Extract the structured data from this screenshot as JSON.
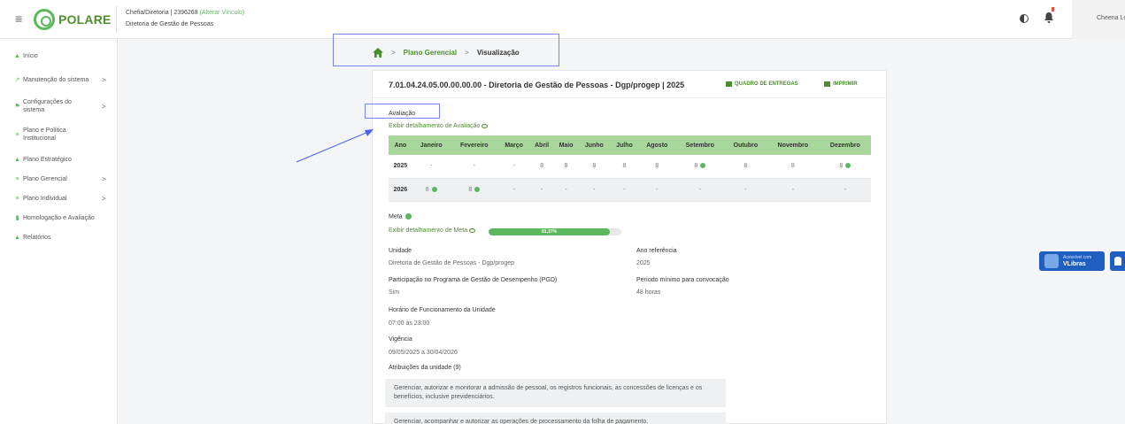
{
  "header": {
    "logo_text": "POLARE",
    "role_prefix": "Chefia/Diretoria | 2396268",
    "role_link": "(Alterar Vínculo)",
    "department": "Diretoria de Gestão de Pessoas",
    "user_name": "Cheena Lope"
  },
  "sidebar": {
    "items": [
      {
        "label": "Início",
        "icon": "home-icon",
        "has_children": false
      },
      {
        "label": "Manutenção do sistema",
        "icon": "wrench-icon",
        "has_children": true
      },
      {
        "label": "Configurações do sistema",
        "icon": "settings-icon",
        "has_children": true
      },
      {
        "label": "Plano e Política Institucional",
        "icon": "list-icon",
        "has_children": false
      },
      {
        "label": "Plano Estratégico",
        "icon": "people-icon",
        "has_children": false
      },
      {
        "label": "Plano Gerencial",
        "icon": "list-icon",
        "has_children": true
      },
      {
        "label": "Plano Individual",
        "icon": "list-icon",
        "has_children": true
      },
      {
        "label": "Homologação e Avaliação",
        "icon": "check-icon",
        "has_children": false
      },
      {
        "label": "Relatórios",
        "icon": "chart-icon",
        "has_children": false
      }
    ],
    "chevron": ">"
  },
  "breadcrumb": {
    "separator": ">",
    "items": [
      "Plano Gerencial",
      "Visualização"
    ]
  },
  "card": {
    "title": "7.01.04.24.05.00.00.00.00 - Diretoria de Gestão de Pessoas - Dgp/progep | 2025",
    "actions": {
      "deliveries": "QUADRO DE ENTREGAS",
      "print": "IMPRIMIR"
    },
    "evaluation": {
      "title": "Avaliação",
      "detail_link": "Exibir detalhamento de Avaliação",
      "columns": [
        "Ano",
        "Janeiro",
        "Fevereiro",
        "Março",
        "Abril",
        "Maio",
        "Junho",
        "Julho",
        "Agosto",
        "Setembro",
        "Outubro",
        "Novembro",
        "Dezembro"
      ],
      "rows": [
        {
          "year": "2025",
          "cells": [
            {
              "v": "-"
            },
            {
              "v": "-"
            },
            {
              "v": "-"
            },
            {
              "v": "8"
            },
            {
              "v": "8"
            },
            {
              "v": "8"
            },
            {
              "v": "8"
            },
            {
              "v": "8"
            },
            {
              "v": "8",
              "dot": true
            },
            {
              "v": "8"
            },
            {
              "v": "8"
            },
            {
              "v": "8",
              "dot": true
            }
          ]
        },
        {
          "year": "2026",
          "cells": [
            {
              "v": "8",
              "dot": true
            },
            {
              "v": "8",
              "dot": true
            },
            {
              "v": "-"
            },
            {
              "v": "-"
            },
            {
              "v": "-"
            },
            {
              "v": "-"
            },
            {
              "v": "-"
            },
            {
              "v": "-"
            },
            {
              "v": "-"
            },
            {
              "v": "-"
            },
            {
              "v": "-"
            },
            {
              "v": "-"
            }
          ]
        }
      ]
    },
    "meta": {
      "title": "Meta",
      "detail_link": "Exibir detalhamento de Meta",
      "progress_percent": 91.37,
      "progress_label": "91,37%"
    },
    "fields": {
      "unidade_label": "Unidade",
      "unidade_value": "Diretoria de Gestão de Pessoas - Dgp/progep",
      "ano_label": "Ano referência",
      "ano_value": "2025",
      "pgd_label": "Participação no Programa de Gestão de Desempenho (PGD)",
      "pgd_value": "Sim",
      "periodo_label": "Período mínimo para convocação",
      "periodo_value": "48 horas",
      "horario_label": "Horário de Funcionamento da Unidade",
      "horario_value": "07:00 às 23:00",
      "vigencia_label": "Vigência",
      "vigencia_value": "09/05/2025 a 30/04/2026",
      "atribuicoes_label": "Atribuições da unidade (9)"
    },
    "attributions": [
      "Gerenciar, autorizar e monitorar a admissão de pessoal, os registros funcionais, as concessões de licenças e os benefícios, inclusive previdenciários.",
      "Gerenciar, acompanhar e autorizar as operações de processamento da folha de pagamento."
    ]
  },
  "vlibras": {
    "line1": "Acessível com",
    "line2": "VLibras"
  },
  "colors": {
    "accent": "#4e8d2f",
    "accent_light": "#5cb85c",
    "table_header": "#a9d69b",
    "annotation": "#7b83f0",
    "vlibras": "#1f5fbf"
  }
}
